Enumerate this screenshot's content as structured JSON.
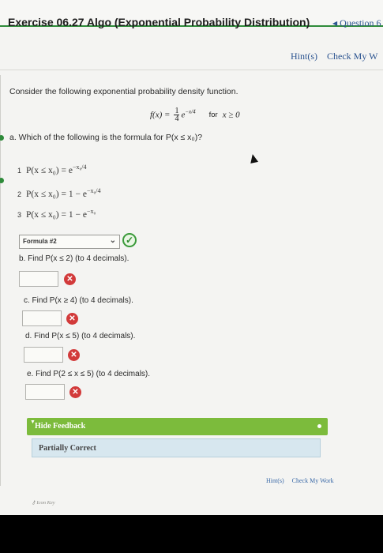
{
  "header": {
    "title": "Exercise 06.27 Algo (Exponential Probability Distribution)",
    "question_nav": "Question 6"
  },
  "top_links": {
    "hints": "Hint(s)",
    "check": "Check My W"
  },
  "problem": {
    "intro": "Consider the following exponential probability density function.",
    "formula_lhs": "f(x) =",
    "frac_num": "1",
    "frac_den": "4",
    "formula_exp_base": "e",
    "formula_exp": "−x/4",
    "formula_for": "for",
    "formula_cond": "x ≥ 0"
  },
  "part_a": {
    "prompt": "a. Which of the following is the formula for P(x ≤ x₀)?",
    "options": [
      {
        "num": "1",
        "text": "P(x ≤ x₀) = e",
        "exp": "−x₀/4"
      },
      {
        "num": "2",
        "text": "P(x ≤ x₀) = 1 − e",
        "exp": "−x₀/4"
      },
      {
        "num": "3",
        "text": "P(x ≤ x₀) = 1 − e",
        "exp": "−x₀"
      }
    ],
    "selected": "Formula #2",
    "selected_arrow": "⌄"
  },
  "part_b": {
    "prompt": "b. Find P(x ≤ 2) (to 4 decimals)."
  },
  "part_c": {
    "prompt": "c. Find P(x ≥ 4) (to 4 decimals)."
  },
  "part_d": {
    "prompt": "d. Find P(x ≤ 5) (to 4 decimals)."
  },
  "part_e": {
    "prompt": "e. Find P(2 ≤ x ≤ 5) (to 4 decimals)."
  },
  "feedback": {
    "toggle_label": "Hide Feedback",
    "status": "Partially Correct"
  },
  "bottom_links": {
    "hints": "Hint(s)",
    "check": "Check My Work"
  },
  "icon_key": "Icon Key",
  "colors": {
    "correct": "#3a9a3a",
    "incorrect": "#d23a3a",
    "feedback_bar": "#7cbb3c",
    "link": "#2c5490"
  }
}
